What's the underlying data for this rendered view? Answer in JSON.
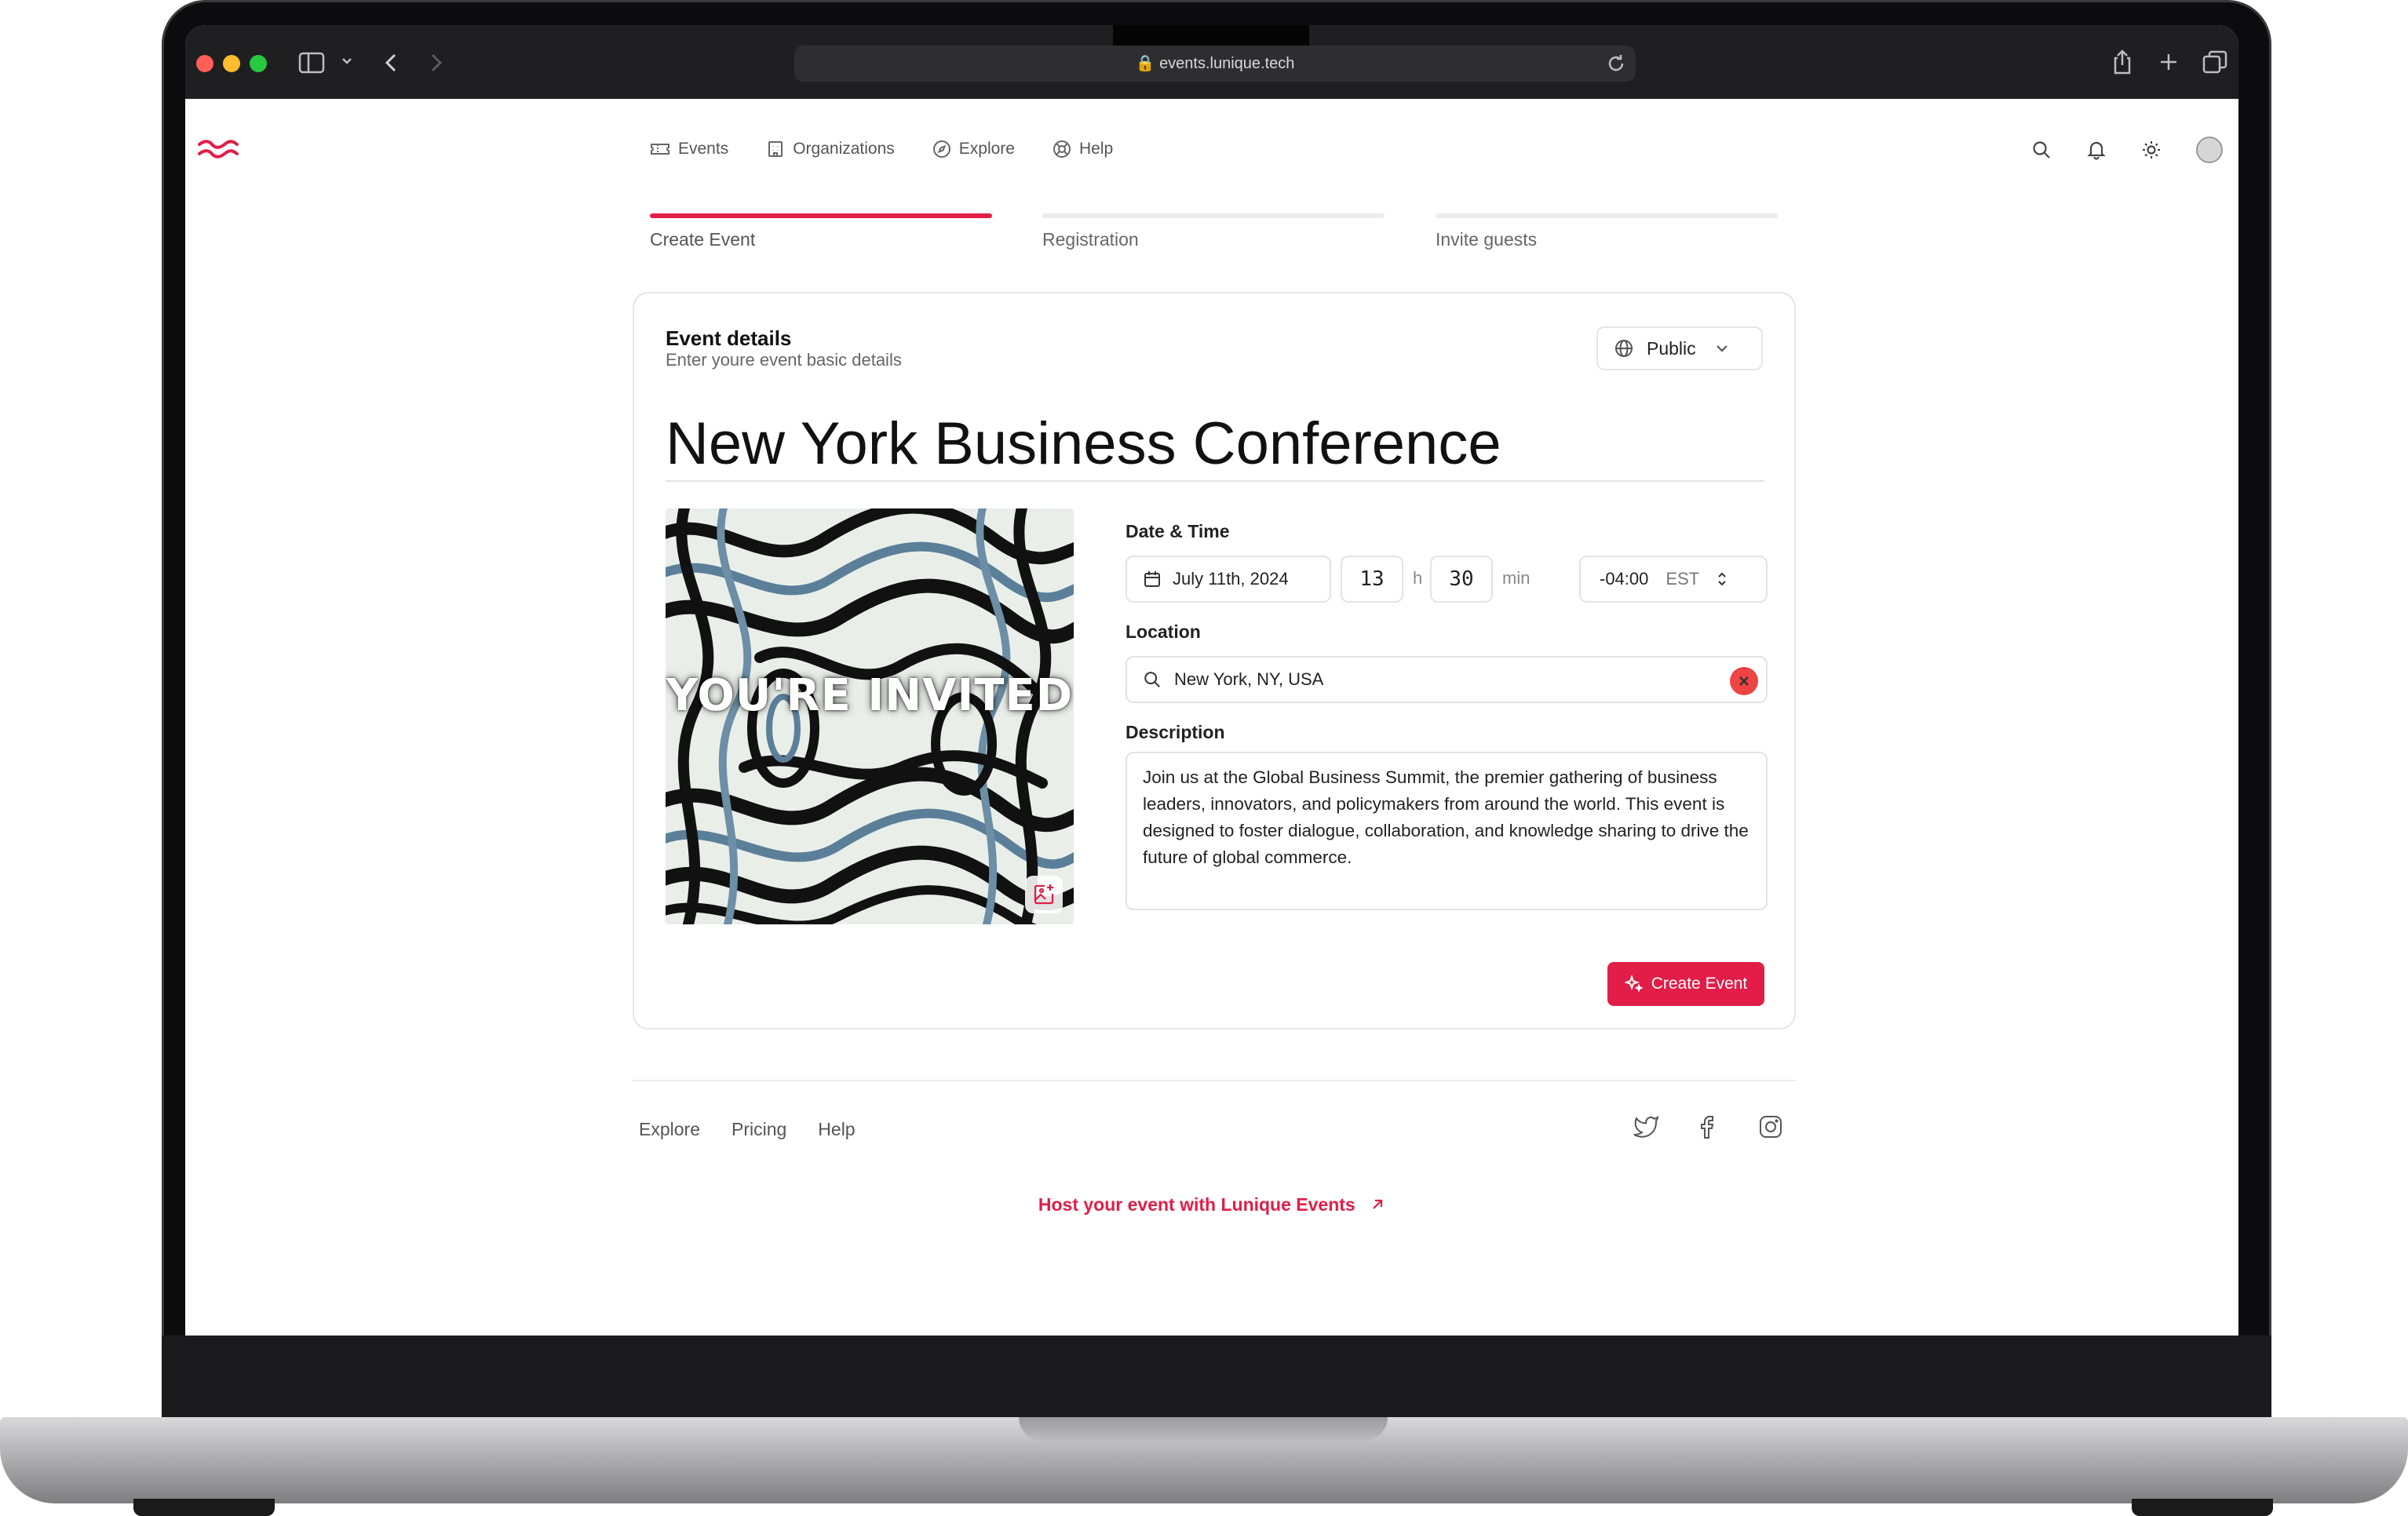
{
  "browser": {
    "url": "events.lunique.tech"
  },
  "nav": {
    "items": [
      {
        "label": "Events",
        "icon": "ticket-icon"
      },
      {
        "label": "Organizations",
        "icon": "building-icon"
      },
      {
        "label": "Explore",
        "icon": "compass-icon"
      },
      {
        "label": "Help",
        "icon": "lifebuoy-icon"
      }
    ]
  },
  "steps": [
    {
      "label": "Create Event",
      "active": true
    },
    {
      "label": "Registration",
      "active": false
    },
    {
      "label": "Invite guests",
      "active": false
    }
  ],
  "card": {
    "title": "Event details",
    "subtitle": "Enter youre event basic details",
    "visibility": "Public",
    "event_name": "New York Business Conference",
    "cover_text": "YOU'RE INVITED",
    "date_time": {
      "label": "Date & Time",
      "date": "July 11th, 2024",
      "hour": "13",
      "hour_unit": "h",
      "minute": "30",
      "minute_unit": "min",
      "offset": "-04:00",
      "timezone": "EST"
    },
    "location": {
      "label": "Location",
      "value": "New York, NY, USA"
    },
    "description": {
      "label": "Description",
      "value": "Join us at the Global Business Summit, the premier gathering of business leaders, innovators, and policymakers from around the world. This event is designed to foster dialogue, collaboration, and knowledge sharing to drive the future of global commerce."
    },
    "submit_label": "Create Event"
  },
  "footer": {
    "links": [
      "Explore",
      "Pricing",
      "Help"
    ],
    "social": [
      "twitter-icon",
      "facebook-icon",
      "instagram-icon"
    ],
    "host_label": "Host your event with Lunique Events"
  },
  "colors": {
    "accent": "#e11d48",
    "danger": "#ef4444"
  }
}
